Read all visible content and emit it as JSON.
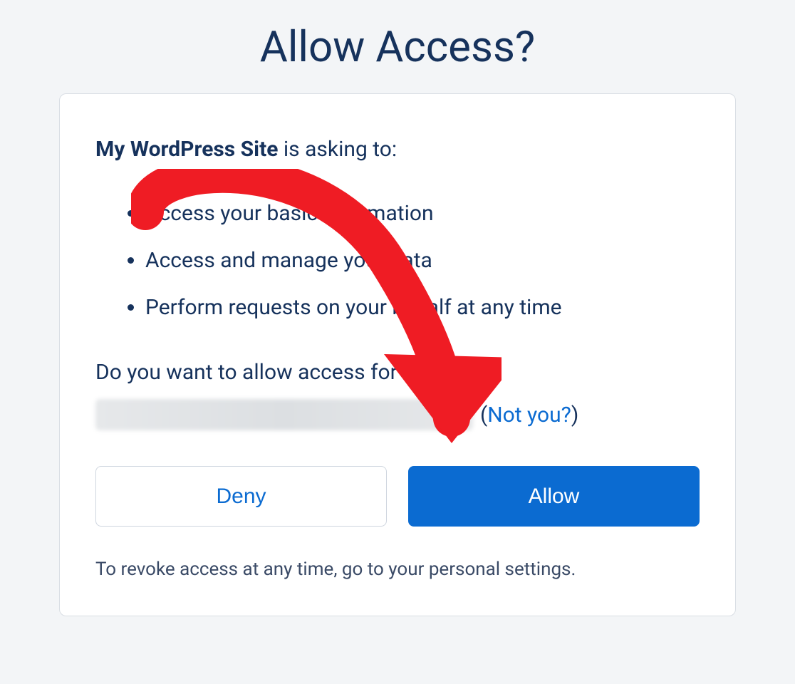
{
  "header": {
    "title": "Allow Access?"
  },
  "card": {
    "app_name": "My WordPress Site",
    "asking_suffix": " is asking to:",
    "permissions": [
      "Access your basic information",
      "Access and manage your data",
      "Perform requests on your behalf at any time"
    ],
    "prompt": "Do you want to allow access for",
    "not_you_open": " (",
    "not_you_label": "Not you?",
    "not_you_close": ")",
    "deny_label": "Deny",
    "allow_label": "Allow",
    "revoke_note": "To revoke access at any time, go to your personal settings."
  }
}
